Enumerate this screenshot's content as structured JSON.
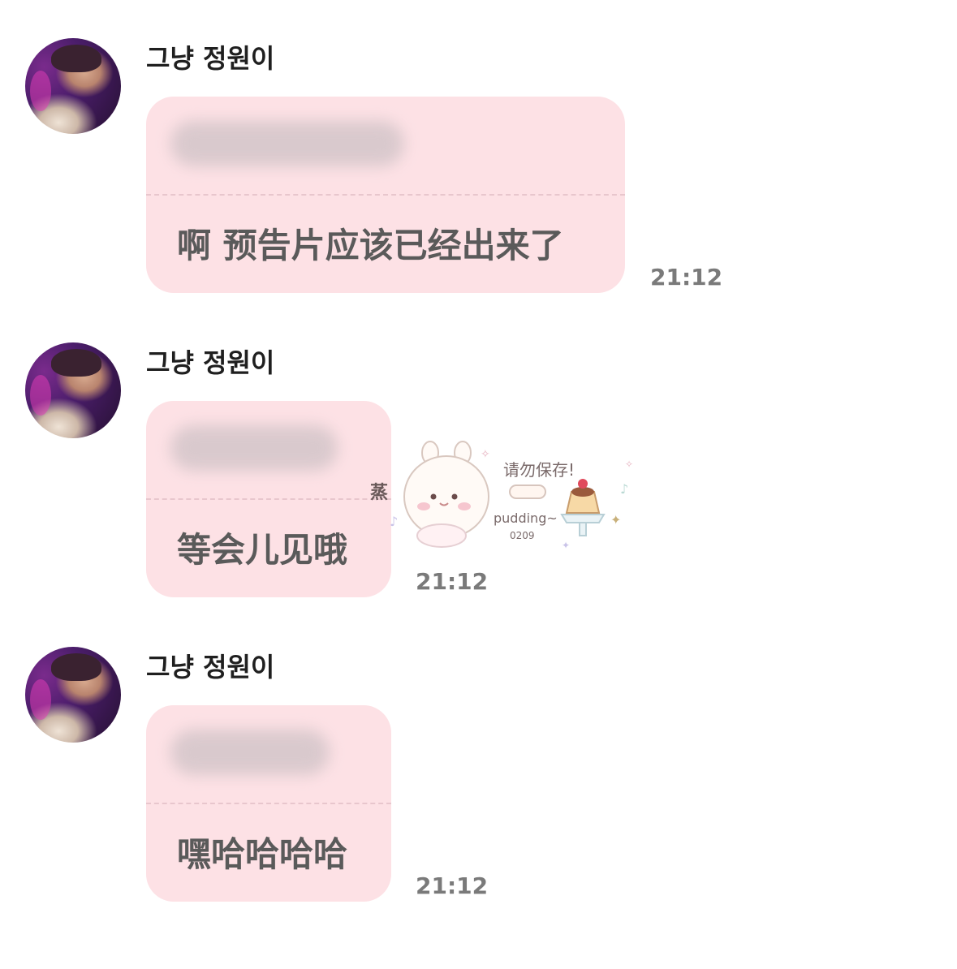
{
  "messages": [
    {
      "sender": "그냥 정원이",
      "quoted_text_blurred": "",
      "text": "啊 预告片应该已经出来了",
      "time": "21:12"
    },
    {
      "sender": "그냥 정원이",
      "quoted_text_blurred": "",
      "text": "等会儿见哦",
      "time": "21:12"
    },
    {
      "sender": "그냥 정원이",
      "quoted_text_blurred": "",
      "text": "嘿哈哈哈哈",
      "time": "21:12"
    }
  ],
  "watermark": {
    "left_char": "蒸",
    "caption": "请勿保存!",
    "brand": "pudding~",
    "code": "0209"
  },
  "colors": {
    "bubble": "#fde1e5",
    "message_text": "#5a5a5a",
    "time_text": "#7a7a7a",
    "sender_text": "#1f1f1f"
  },
  "icons": {
    "avatar": "profile-photo",
    "watermark": "bunny-pudding-sticker"
  }
}
